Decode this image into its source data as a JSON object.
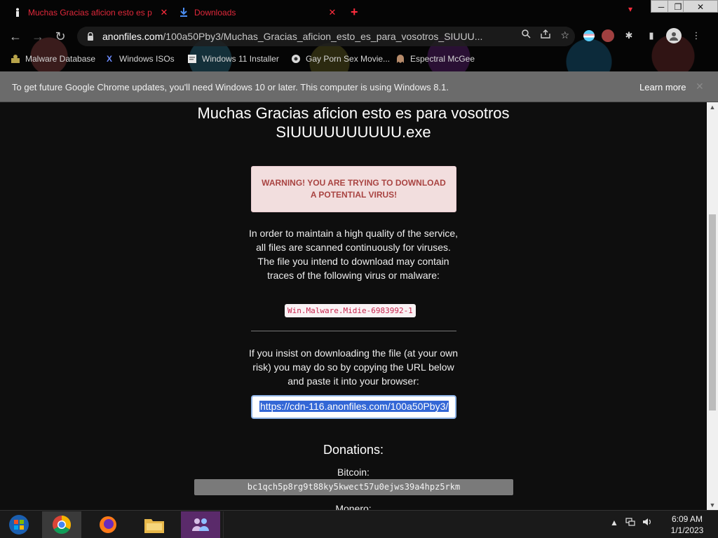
{
  "tabs": [
    {
      "title": "Muchas Gracias aficion esto es p",
      "favicon": "figure-icon"
    },
    {
      "title": "Downloads",
      "favicon": "download-icon"
    }
  ],
  "window": {
    "minimize": "─",
    "maximize": "❐",
    "close": "✕"
  },
  "omnibox": {
    "host": "anonfiles.com",
    "path": "/100a50Pby3/Muchas_Gracias_aficion_esto_es_para_vosotros_SIUUU..."
  },
  "bookmarks": [
    {
      "label": "Malware Database"
    },
    {
      "label": "Windows ISOs"
    },
    {
      "label": "Windows 11 Installer"
    },
    {
      "label": "Gay Porn Sex Movie..."
    },
    {
      "label": "Espectral McGee"
    }
  ],
  "infobar": {
    "message": "To get future Google Chrome updates, you'll need Windows 10 or later. This computer is using Windows 8.1.",
    "link": "Learn more",
    "close": "✕"
  },
  "page": {
    "title": "Muchas Gracias aficion esto es para vosotros SIUUUUUUUUUU.exe",
    "warning": "WARNING! YOU ARE TRYING TO DOWNLOAD A POTENTIAL VIRUS!",
    "scan_text": "In order to maintain a high quality of the service, all files are scanned continuously for viruses. The file you intend to download may contain traces of the following virus or malware:",
    "virus_name": "Win.Malware.Midie-6983992-1",
    "insist_text": "If you insist on downloading the file (at your own risk) you may do so by copying the URL below and paste it into your browser:",
    "download_url": "https://cdn-116.anonfiles.com/100a50Pby3/",
    "donations_title": "Donations:",
    "bitcoin_label": "Bitcoin:",
    "bitcoin_address": "bc1qch5p8rg9t88ky5kwect57u0ejws39a4hpz5rkm",
    "monero_label": "Monero:"
  },
  "clock": {
    "time": "6:09 AM",
    "date": "1/1/2023"
  },
  "colors": {
    "tab_text": "#e0283a",
    "warning_bg": "#f2dede",
    "warning_text": "#a94442",
    "infobar_bg": "#6b6b6b",
    "selection": "#3367d6"
  }
}
